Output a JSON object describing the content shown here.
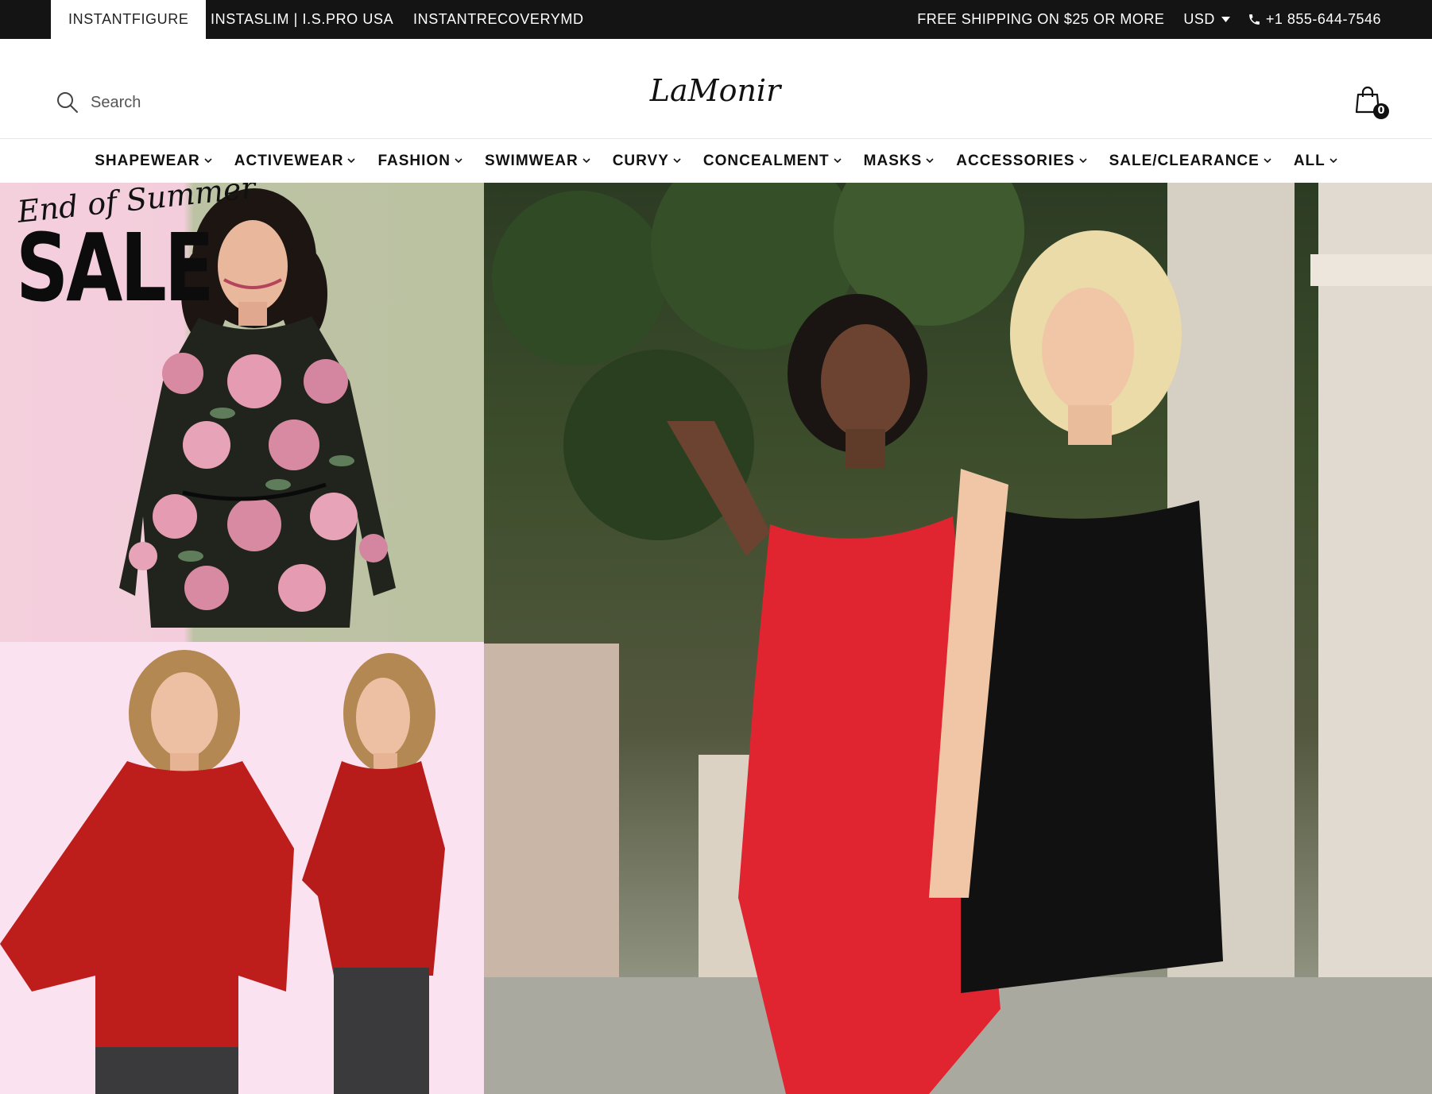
{
  "topbar": {
    "stores": [
      {
        "label": "INSTANTFIGURE",
        "active": true
      },
      {
        "label": "INSTASLIM | I.S.PRO USA",
        "active": false
      },
      {
        "label": "INSTANTRECOVERYMD",
        "active": false
      }
    ],
    "promo": "FREE SHIPPING ON $25 OR MORE",
    "currency": "USD",
    "phone": "+1 855-644-7546"
  },
  "header": {
    "search_placeholder": "Search",
    "logo_text": "LaMonir",
    "cart_count": "0"
  },
  "nav": {
    "items": [
      {
        "label": "SHAPEWEAR"
      },
      {
        "label": "ACTIVEWEAR"
      },
      {
        "label": "FASHION"
      },
      {
        "label": "SWIMWEAR"
      },
      {
        "label": "CURVY"
      },
      {
        "label": "CONCEALMENT"
      },
      {
        "label": "MASKS"
      },
      {
        "label": "ACCESSORIES"
      },
      {
        "label": "SALE/CLEARANCE"
      },
      {
        "label": "ALL"
      }
    ]
  },
  "banners": {
    "sale": {
      "script_text": "End of Summer",
      "headline": "SALE"
    }
  },
  "colors": {
    "topbar_bg": "#141414",
    "sale_pink": "#f4cfdc",
    "sale_olive": "#bbc2a2",
    "capes_pink": "#fbe2f1",
    "red_garment": "#c0201d",
    "dress_red": "#e02430"
  }
}
